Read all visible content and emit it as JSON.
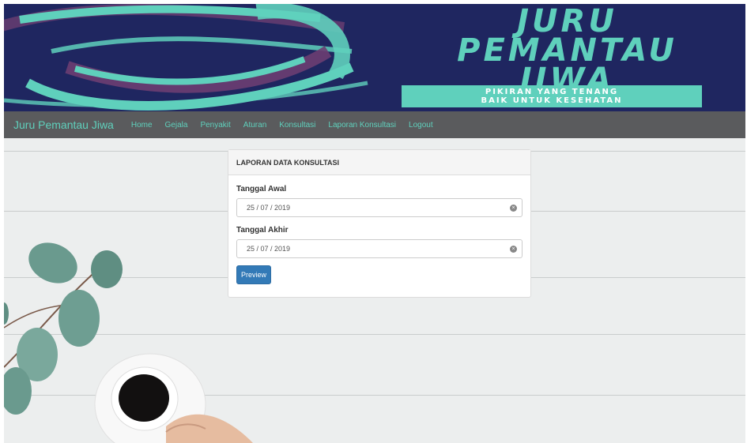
{
  "banner": {
    "title_lines": [
      "JURU",
      "PEMANTAU",
      "JIWA"
    ],
    "tagline_lines": [
      "PIKIRAN YANG TENANG",
      "BAIK UNTUK KESEHATAN"
    ],
    "colors": {
      "background": "#1f2660",
      "accent": "#5fd0bc",
      "brush_purple": "#6b3e72"
    }
  },
  "navbar": {
    "brand": "Juru Pemantau Jiwa",
    "items": [
      "Home",
      "Gejala",
      "Penyakit",
      "Aturan",
      "Konsultasi",
      "Laporan Konsultasi",
      "Logout"
    ]
  },
  "card": {
    "header": "LAPORAN DATA KONSULTASI",
    "start_label": "Tanggal Awal",
    "start_value": "25 / 07 / 2019",
    "end_label": "Tanggal Akhir",
    "end_value": "25 / 07 / 2019",
    "button_label": "Preview"
  },
  "icons": {
    "date_clear": "clear-circle-icon"
  }
}
